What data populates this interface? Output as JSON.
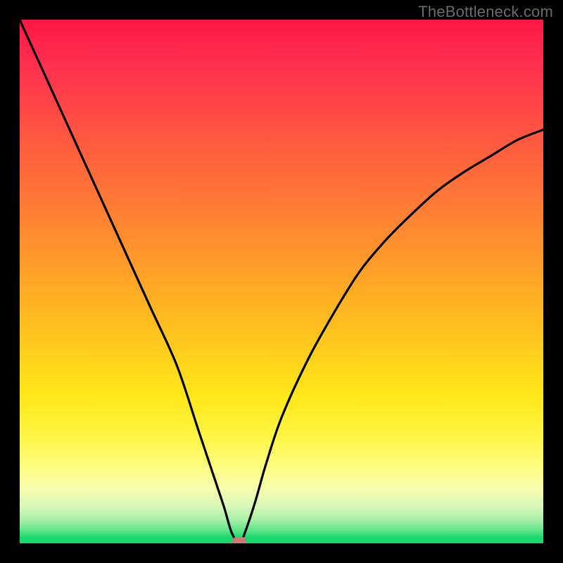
{
  "watermark": "TheBottleneck.com",
  "colors": {
    "background": "#000000",
    "curve": "#000000",
    "marker": "#cf7a78",
    "gradient_top": "#ff1744",
    "gradient_mid": "#ffe81a",
    "gradient_bottom": "#14d96d"
  },
  "chart_data": {
    "type": "line",
    "title": "",
    "xlabel": "",
    "ylabel": "",
    "xlim": [
      0,
      100
    ],
    "ylim": [
      0,
      100
    ],
    "grid": false,
    "legend": false,
    "series": [
      {
        "name": "bottleneck-curve",
        "x": [
          0,
          5,
          10,
          15,
          20,
          25,
          30,
          34,
          37,
          39,
          40.5,
          42,
          43,
          45,
          47,
          50,
          55,
          60,
          65,
          70,
          75,
          80,
          85,
          90,
          95,
          100
        ],
        "values": [
          100,
          89,
          78,
          67,
          56,
          45,
          34,
          22,
          13,
          7,
          2,
          0,
          2,
          8,
          15,
          24,
          35,
          44,
          52,
          58,
          63,
          67.5,
          71,
          74,
          77,
          79
        ]
      }
    ],
    "annotations": [
      {
        "name": "optimal-marker",
        "x": 42,
        "y": 0
      }
    ]
  }
}
